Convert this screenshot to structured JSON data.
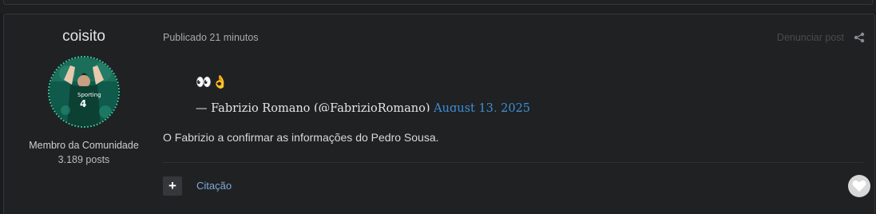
{
  "post": {
    "author": {
      "name": "coisito",
      "member_title": "Membro da Comunidade",
      "posts": "3.189 posts"
    },
    "published": "Publicado 21 minutos",
    "report_label": "Denunciar post",
    "embed": {
      "emoji": "👀👌",
      "attribution": "— Fabrizio Romano (@FabrizioRomano)",
      "date": "August 13, 2025"
    },
    "content": "O Fabrizio a confirmar as informações do Pedro Sousa.",
    "actions": {
      "multiquote_symbol": "+",
      "quote_label": "Citação"
    },
    "icons": {
      "share": "share-icon",
      "like": "heart-icon",
      "multiquote": "plus-icon"
    }
  }
}
